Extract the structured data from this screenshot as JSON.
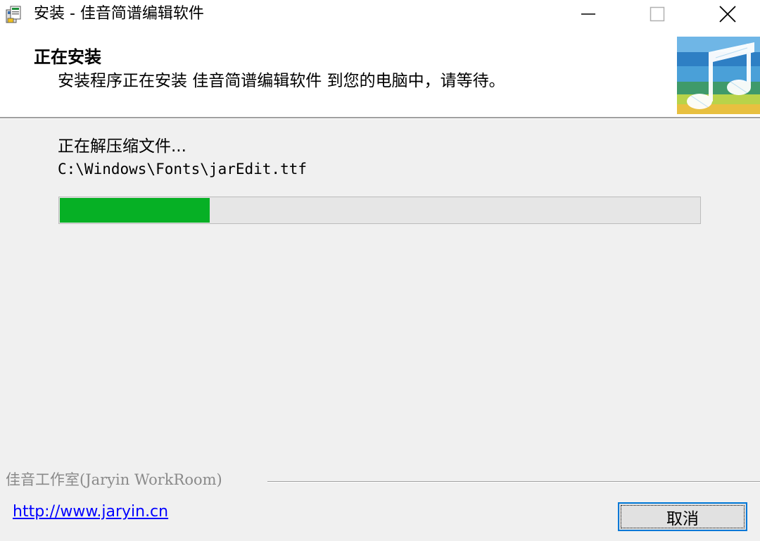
{
  "window": {
    "title": "安装 - 佳音简谱编辑软件"
  },
  "header": {
    "title": "正在安装",
    "subtitle": "安装程序正在安装 佳音简谱编辑软件 到您的电脑中，请等待。"
  },
  "install": {
    "status": "正在解压缩文件...",
    "current_file": "C:\\Windows\\Fonts\\jarEdit.ttf",
    "progress_percent": 23.4
  },
  "footer": {
    "brand_label": "佳音工作室(Jaryin WorkRoom)",
    "link_text": "http://www.jaryin.cn",
    "cancel_label": "取消"
  },
  "colors": {
    "progress_fill": "#06b025",
    "link": "#0000ff",
    "focus_border": "#0078d7"
  },
  "icons": {
    "app": "installer-icon",
    "minimize": "minimize-icon",
    "maximize": "maximize-icon",
    "close": "close-icon",
    "banner": "music-note-banner"
  }
}
